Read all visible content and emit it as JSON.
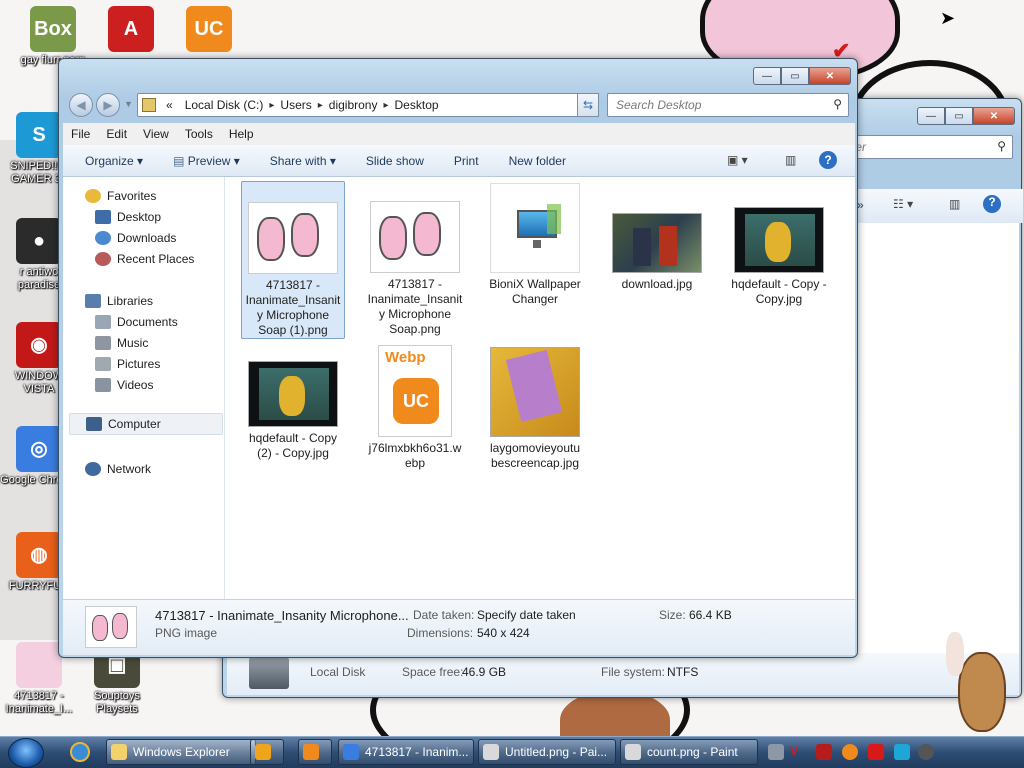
{
  "desktop": {
    "icons": [
      {
        "label": "gay flurr porn",
        "color": "#7a9a4a",
        "glyph": "Box"
      },
      {
        "label": "",
        "color": "#cc1f1f",
        "glyph": "A"
      },
      {
        "label": "",
        "color": "#f08a1d",
        "glyph": "UC"
      },
      {
        "label": "SNIPED!! E GAMER 36",
        "color": "#1d9ad6",
        "glyph": "S"
      },
      {
        "label": "r antiwo paradise",
        "color": "#2b2b2b",
        "glyph": "●"
      },
      {
        "label": "WINDOW VISTA",
        "color": "#c21818",
        "glyph": "◉"
      },
      {
        "label": "Google Chrome",
        "color": "#3a7de0",
        "glyph": "◎"
      },
      {
        "label": "FURRYFUC",
        "color": "#e8601a",
        "glyph": "◍"
      },
      {
        "label": "4713817 - Inanimate_I...",
        "color": "#f3cfe0",
        "glyph": ""
      },
      {
        "label": "Souptoys Playsets",
        "color": "#4a4a3a",
        "glyph": "▣"
      }
    ]
  },
  "back_window": {
    "search_partial": "ter",
    "details": {
      "name_label": "Local Disk",
      "space_free_label": "Space free:",
      "space_free_value": "46.9 GB",
      "fs_label": "File system:",
      "fs_value": "NTFS"
    }
  },
  "explorer": {
    "title_buttons": {
      "minimize": "—",
      "maximize": "▭",
      "close": "✕"
    },
    "address": {
      "prefix": "«",
      "crumbs": [
        "Local Disk (C:)",
        "Users",
        "digibrony",
        "Desktop"
      ]
    },
    "search_placeholder": "Search Desktop",
    "menu": [
      "File",
      "Edit",
      "View",
      "Tools",
      "Help"
    ],
    "commands": {
      "organize": "Organize",
      "preview": "Preview",
      "share": "Share with",
      "slideshow": "Slide show",
      "print": "Print",
      "newfolder": "New folder"
    },
    "nav": {
      "favorites": "Favorites",
      "desktop": "Desktop",
      "downloads": "Downloads",
      "recent": "Recent Places",
      "libraries": "Libraries",
      "documents": "Documents",
      "music": "Music",
      "pictures": "Pictures",
      "videos": "Videos",
      "computer": "Computer",
      "network": "Network"
    },
    "files": [
      {
        "name": "4713817 - Inanimate_Insanit y Microphone Soap (1).png",
        "kind": "pink"
      },
      {
        "name": "4713817 - Inanimate_Insanit y Microphone Soap.png",
        "kind": "pink"
      },
      {
        "name": "BioniX Wallpaper Changer",
        "kind": "monitor"
      },
      {
        "name": "download.jpg",
        "kind": "lego"
      },
      {
        "name": "hqdefault - Copy - Copy.jpg",
        "kind": "lego2"
      },
      {
        "name": "hqdefault - Copy (2) - Copy.jpg",
        "kind": "lego2"
      },
      {
        "name": "j76lmxbkh6o31.w ebp",
        "kind": "webp"
      },
      {
        "name": "laygomovieyoutu bescreencap.jpg",
        "kind": "yellow"
      }
    ],
    "webp_badge": "Webp",
    "details": {
      "name": "4713817 - Inanimate_Insanity Microphone...",
      "type": "PNG image",
      "date_label": "Date taken:",
      "date_value": "Specify date taken",
      "dim_label": "Dimensions:",
      "dim_value": "540 x 424",
      "size_label": "Size:",
      "size_value": "66.4 KB"
    }
  },
  "taskbar": {
    "buttons": [
      {
        "label": "Windows Explorer",
        "color": "#f3d26b"
      },
      {
        "label": "",
        "color": "#f0a41b"
      },
      {
        "label": "",
        "color": "#f08a1d"
      },
      {
        "label": "4713817 - Inanim...",
        "color": "#3a7de0"
      },
      {
        "label": "Untitled.png - Pai...",
        "color": "#d9d9d9"
      },
      {
        "label": "count.png - Paint",
        "color": "#d9d9d9"
      }
    ]
  }
}
